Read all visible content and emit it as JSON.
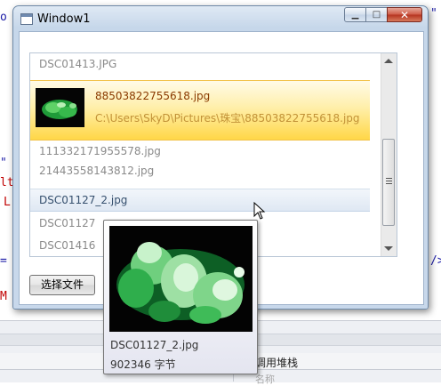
{
  "window": {
    "title": "Window1",
    "controls": {
      "minimize": "▁",
      "maximize": "□",
      "close": "✕"
    }
  },
  "list": {
    "items": [
      {
        "name": "DSC01413.JPG",
        "state": "normal"
      },
      {
        "name": "88503822755618.jpg",
        "path": "C:\\Users\\SkyD\\Pictures\\珠宝\\88503822755618.jpg",
        "state": "selected"
      },
      {
        "name": "111332171955578.jpg",
        "state": "normal"
      },
      {
        "name": "21443558143812.jpg",
        "state": "normal"
      },
      {
        "name": "DSC01127_2.jpg",
        "state": "hover"
      },
      {
        "name": "DSC01127",
        "state": "normal"
      },
      {
        "name": "DSC01416",
        "state": "normal"
      }
    ]
  },
  "buttons": {
    "choose_file": "选择文件"
  },
  "tooltip": {
    "file_name": "DSC01127_2.jpg",
    "file_size": "902346 字节"
  },
  "background_ide": {
    "panel_tab_label": "调用堆栈",
    "panel_column_label": "名称"
  },
  "colors": {
    "selection_gradient_end": "#ffd747",
    "selected_name_color": "#8a3a00",
    "selected_path_color": "#c29238",
    "hover_text_color": "#36506e",
    "normal_text_color": "#8a8a8a"
  },
  "icons": [
    "window-app-icon",
    "minimize-icon",
    "maximize-icon",
    "close-icon",
    "scroll-up-icon",
    "scroll-down-icon",
    "mouse-cursor-icon"
  ]
}
